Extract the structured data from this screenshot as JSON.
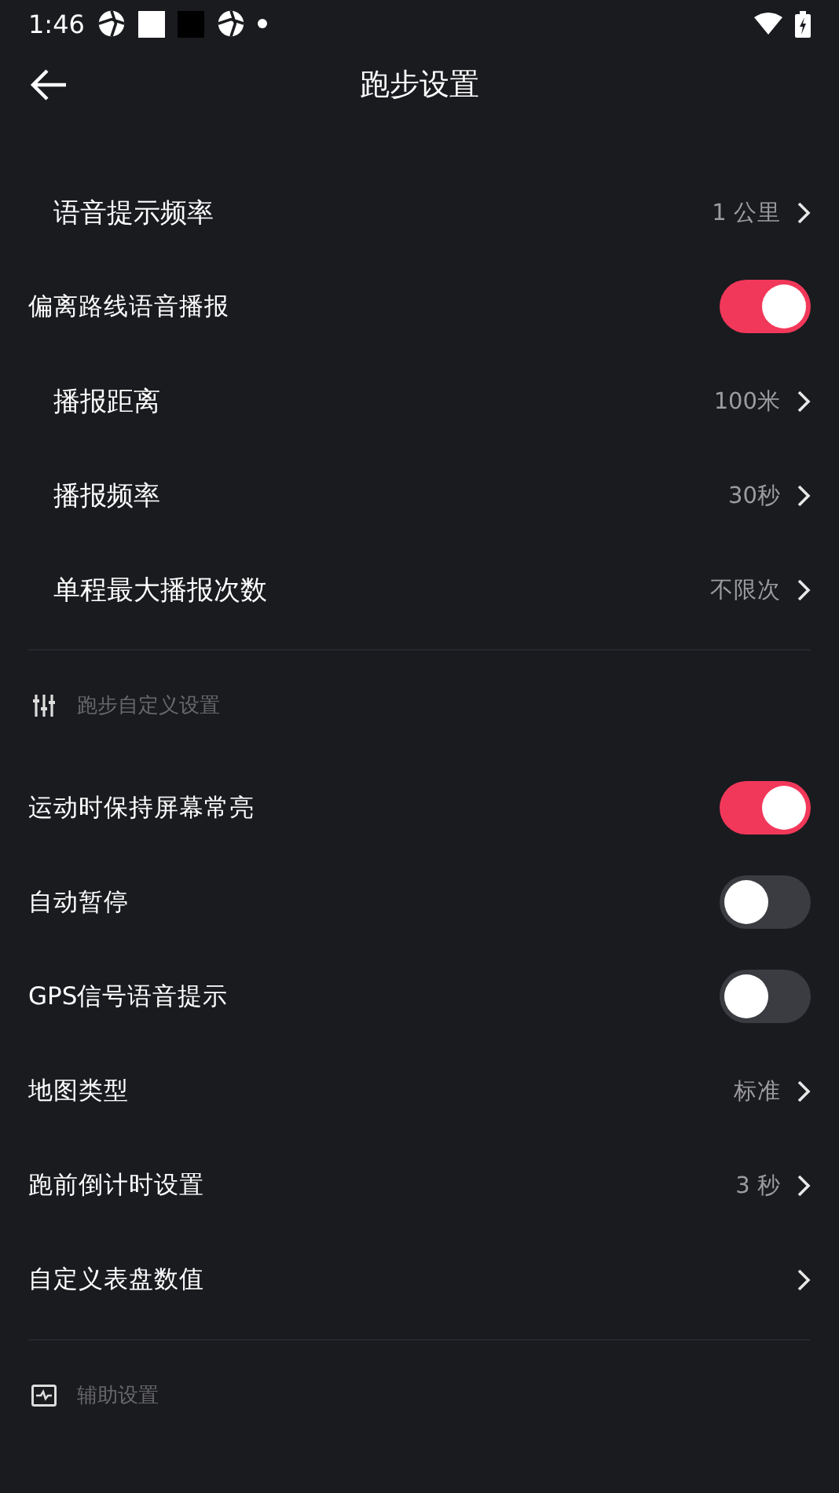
{
  "status_bar": {
    "time": "1:46"
  },
  "header": {
    "title": "跑步设置"
  },
  "groups": [
    {
      "items": [
        {
          "kind": "link",
          "label": "语音提示频率",
          "value": "1 公里",
          "indented": true
        },
        {
          "kind": "toggle",
          "label": "偏离路线语音播报",
          "on": true,
          "indented": false
        },
        {
          "kind": "link",
          "label": "播报距离",
          "value": "100米",
          "indented": true
        },
        {
          "kind": "link",
          "label": "播报频率",
          "value": "30秒",
          "indented": true
        },
        {
          "kind": "link",
          "label": "单程最大播报次数",
          "value": "不限次",
          "indented": true
        }
      ]
    },
    {
      "header": {
        "title": "跑步自定义设置"
      },
      "items": [
        {
          "kind": "toggle",
          "label": "运动时保持屏幕常亮",
          "on": true,
          "indented": false
        },
        {
          "kind": "toggle",
          "label": "自动暂停",
          "on": false,
          "indented": false
        },
        {
          "kind": "toggle",
          "label": "GPS信号语音提示",
          "on": false,
          "indented": false
        },
        {
          "kind": "link",
          "label": "地图类型",
          "value": "标准",
          "indented": false
        },
        {
          "kind": "link",
          "label": "跑前倒计时设置",
          "value": "3 秒",
          "indented": false
        },
        {
          "kind": "link",
          "label": "自定义表盘数值",
          "indented": false
        }
      ]
    },
    {
      "header": {
        "title": "辅助设置"
      }
    }
  ]
}
